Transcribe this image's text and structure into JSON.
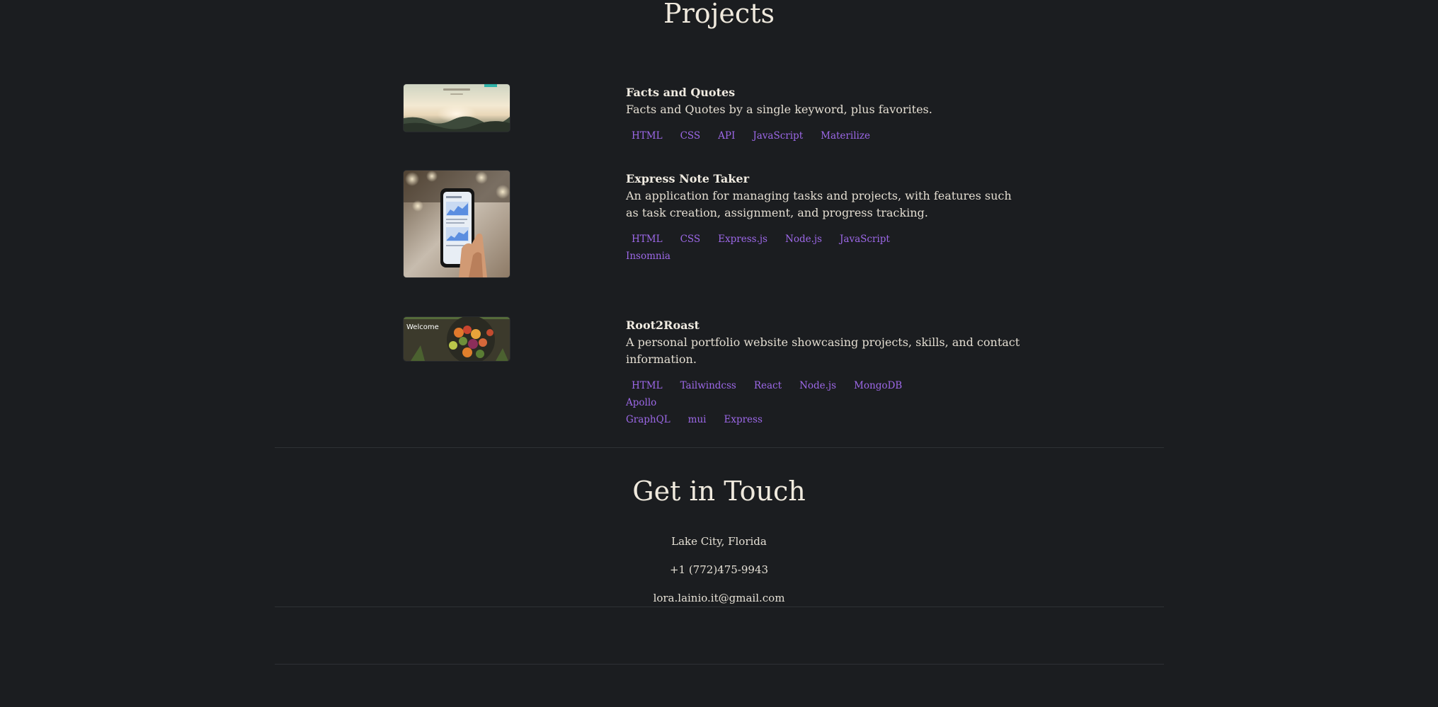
{
  "projects_section": {
    "title": "Projects",
    "items": [
      {
        "title": "Facts and Quotes",
        "description": "Facts and Quotes by a single keyword, plus favorites.",
        "tags": [
          "HTML",
          "CSS",
          "API",
          "JavaScript",
          "Materilize"
        ],
        "image_alt": "Facts and Quotes screenshot"
      },
      {
        "title": "Express Note Taker",
        "description": "An application for managing tasks and projects, with features such as task creation, assignment, and progress tracking.",
        "tags": [
          "HTML",
          "CSS",
          "Express.js",
          "Node.js",
          "JavaScript",
          "Insomnia"
        ],
        "image_alt": "Hand holding a phone showing the note app"
      },
      {
        "title": "Root2Roast",
        "description": "A personal portfolio website showcasing projects, skills, and contact information.",
        "tags": [
          "HTML",
          "Tailwindcss",
          "React",
          "Node.js",
          "MongoDB",
          "Apollo",
          "GraphQL",
          "mui",
          "Express"
        ],
        "image_alt": "Root2Roast welcome screen with vegetables",
        "image_text": "Welcome"
      }
    ]
  },
  "contact_section": {
    "title": "Get in Touch",
    "location": "Lake City, Florida",
    "phone": "+1 (772)475-9943",
    "email": "lora.lainio.it@gmail.com"
  },
  "colors": {
    "background": "#1b1d20",
    "text": "#e6e1d6",
    "tag": "#9d68e8",
    "divider": "#2e3135"
  }
}
